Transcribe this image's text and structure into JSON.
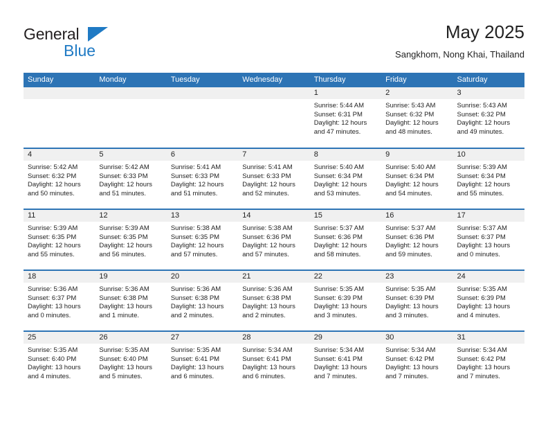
{
  "brand": {
    "name_top": "General",
    "name_bottom": "Blue",
    "triangle_color": "#1f7ac4"
  },
  "header": {
    "title": "May 2025",
    "subtitle": "Sangkhom, Nong Khai, Thailand"
  },
  "theme": {
    "accent": "#2d74b5",
    "daynum_bg": "#f0f0f0",
    "text": "#222222"
  },
  "calendar": {
    "weekday_headers": [
      "Sunday",
      "Monday",
      "Tuesday",
      "Wednesday",
      "Thursday",
      "Friday",
      "Saturday"
    ],
    "weeks": [
      [
        {
          "day": "",
          "lines": []
        },
        {
          "day": "",
          "lines": []
        },
        {
          "day": "",
          "lines": []
        },
        {
          "day": "",
          "lines": []
        },
        {
          "day": "1",
          "lines": [
            "Sunrise: 5:44 AM",
            "Sunset: 6:31 PM",
            "Daylight: 12 hours",
            "and 47 minutes."
          ]
        },
        {
          "day": "2",
          "lines": [
            "Sunrise: 5:43 AM",
            "Sunset: 6:32 PM",
            "Daylight: 12 hours",
            "and 48 minutes."
          ]
        },
        {
          "day": "3",
          "lines": [
            "Sunrise: 5:43 AM",
            "Sunset: 6:32 PM",
            "Daylight: 12 hours",
            "and 49 minutes."
          ]
        }
      ],
      [
        {
          "day": "4",
          "lines": [
            "Sunrise: 5:42 AM",
            "Sunset: 6:32 PM",
            "Daylight: 12 hours",
            "and 50 minutes."
          ]
        },
        {
          "day": "5",
          "lines": [
            "Sunrise: 5:42 AM",
            "Sunset: 6:33 PM",
            "Daylight: 12 hours",
            "and 51 minutes."
          ]
        },
        {
          "day": "6",
          "lines": [
            "Sunrise: 5:41 AM",
            "Sunset: 6:33 PM",
            "Daylight: 12 hours",
            "and 51 minutes."
          ]
        },
        {
          "day": "7",
          "lines": [
            "Sunrise: 5:41 AM",
            "Sunset: 6:33 PM",
            "Daylight: 12 hours",
            "and 52 minutes."
          ]
        },
        {
          "day": "8",
          "lines": [
            "Sunrise: 5:40 AM",
            "Sunset: 6:34 PM",
            "Daylight: 12 hours",
            "and 53 minutes."
          ]
        },
        {
          "day": "9",
          "lines": [
            "Sunrise: 5:40 AM",
            "Sunset: 6:34 PM",
            "Daylight: 12 hours",
            "and 54 minutes."
          ]
        },
        {
          "day": "10",
          "lines": [
            "Sunrise: 5:39 AM",
            "Sunset: 6:34 PM",
            "Daylight: 12 hours",
            "and 55 minutes."
          ]
        }
      ],
      [
        {
          "day": "11",
          "lines": [
            "Sunrise: 5:39 AM",
            "Sunset: 6:35 PM",
            "Daylight: 12 hours",
            "and 55 minutes."
          ]
        },
        {
          "day": "12",
          "lines": [
            "Sunrise: 5:39 AM",
            "Sunset: 6:35 PM",
            "Daylight: 12 hours",
            "and 56 minutes."
          ]
        },
        {
          "day": "13",
          "lines": [
            "Sunrise: 5:38 AM",
            "Sunset: 6:35 PM",
            "Daylight: 12 hours",
            "and 57 minutes."
          ]
        },
        {
          "day": "14",
          "lines": [
            "Sunrise: 5:38 AM",
            "Sunset: 6:36 PM",
            "Daylight: 12 hours",
            "and 57 minutes."
          ]
        },
        {
          "day": "15",
          "lines": [
            "Sunrise: 5:37 AM",
            "Sunset: 6:36 PM",
            "Daylight: 12 hours",
            "and 58 minutes."
          ]
        },
        {
          "day": "16",
          "lines": [
            "Sunrise: 5:37 AM",
            "Sunset: 6:36 PM",
            "Daylight: 12 hours",
            "and 59 minutes."
          ]
        },
        {
          "day": "17",
          "lines": [
            "Sunrise: 5:37 AM",
            "Sunset: 6:37 PM",
            "Daylight: 13 hours",
            "and 0 minutes."
          ]
        }
      ],
      [
        {
          "day": "18",
          "lines": [
            "Sunrise: 5:36 AM",
            "Sunset: 6:37 PM",
            "Daylight: 13 hours",
            "and 0 minutes."
          ]
        },
        {
          "day": "19",
          "lines": [
            "Sunrise: 5:36 AM",
            "Sunset: 6:38 PM",
            "Daylight: 13 hours",
            "and 1 minute."
          ]
        },
        {
          "day": "20",
          "lines": [
            "Sunrise: 5:36 AM",
            "Sunset: 6:38 PM",
            "Daylight: 13 hours",
            "and 2 minutes."
          ]
        },
        {
          "day": "21",
          "lines": [
            "Sunrise: 5:36 AM",
            "Sunset: 6:38 PM",
            "Daylight: 13 hours",
            "and 2 minutes."
          ]
        },
        {
          "day": "22",
          "lines": [
            "Sunrise: 5:35 AM",
            "Sunset: 6:39 PM",
            "Daylight: 13 hours",
            "and 3 minutes."
          ]
        },
        {
          "day": "23",
          "lines": [
            "Sunrise: 5:35 AM",
            "Sunset: 6:39 PM",
            "Daylight: 13 hours",
            "and 3 minutes."
          ]
        },
        {
          "day": "24",
          "lines": [
            "Sunrise: 5:35 AM",
            "Sunset: 6:39 PM",
            "Daylight: 13 hours",
            "and 4 minutes."
          ]
        }
      ],
      [
        {
          "day": "25",
          "lines": [
            "Sunrise: 5:35 AM",
            "Sunset: 6:40 PM",
            "Daylight: 13 hours",
            "and 4 minutes."
          ]
        },
        {
          "day": "26",
          "lines": [
            "Sunrise: 5:35 AM",
            "Sunset: 6:40 PM",
            "Daylight: 13 hours",
            "and 5 minutes."
          ]
        },
        {
          "day": "27",
          "lines": [
            "Sunrise: 5:35 AM",
            "Sunset: 6:41 PM",
            "Daylight: 13 hours",
            "and 6 minutes."
          ]
        },
        {
          "day": "28",
          "lines": [
            "Sunrise: 5:34 AM",
            "Sunset: 6:41 PM",
            "Daylight: 13 hours",
            "and 6 minutes."
          ]
        },
        {
          "day": "29",
          "lines": [
            "Sunrise: 5:34 AM",
            "Sunset: 6:41 PM",
            "Daylight: 13 hours",
            "and 7 minutes."
          ]
        },
        {
          "day": "30",
          "lines": [
            "Sunrise: 5:34 AM",
            "Sunset: 6:42 PM",
            "Daylight: 13 hours",
            "and 7 minutes."
          ]
        },
        {
          "day": "31",
          "lines": [
            "Sunrise: 5:34 AM",
            "Sunset: 6:42 PM",
            "Daylight: 13 hours",
            "and 7 minutes."
          ]
        }
      ]
    ]
  }
}
